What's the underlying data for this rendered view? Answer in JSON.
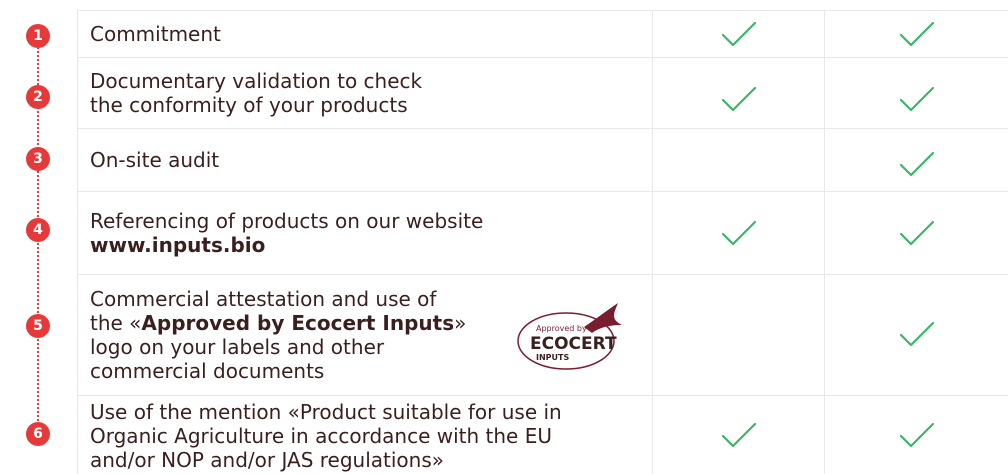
{
  "rows": [
    {
      "number": "1",
      "text": "Commitment",
      "col1": true,
      "col2": true
    },
    {
      "number": "2",
      "line1": "Documentary validation to check",
      "line2": "the conformity of your products",
      "col1": true,
      "col2": true
    },
    {
      "number": "3",
      "text": "On-site audit",
      "col1": false,
      "col2": true
    },
    {
      "number": "4",
      "line1": "Referencing of products on our website",
      "link": "www.inputs.bio",
      "col1": true,
      "col2": true
    },
    {
      "number": "5",
      "line1": "Commercial attestation and use of",
      "prefix": "the «",
      "strong": "Approved by Ecocert Inputs",
      "suffix": "»",
      "line3": "logo on your labels and other",
      "line4": "commercial documents",
      "col1": false,
      "col2": true
    },
    {
      "number": "6",
      "line1": "Use of the mention «Product suitable for use in",
      "line2": "Organic Agriculture in accordance with the EU",
      "line3": "and/or NOP and/or JAS regulations»",
      "col1": true,
      "col2": true
    }
  ],
  "logo": {
    "top": "Approved by",
    "main": "ECOCERT",
    "sub": "INPUTS"
  },
  "colors": {
    "accent": "#e63a3a",
    "check": "#3cb56a",
    "text": "#3a1f1f",
    "border": "#e8e8e8",
    "logo": "#7a1d2e"
  }
}
